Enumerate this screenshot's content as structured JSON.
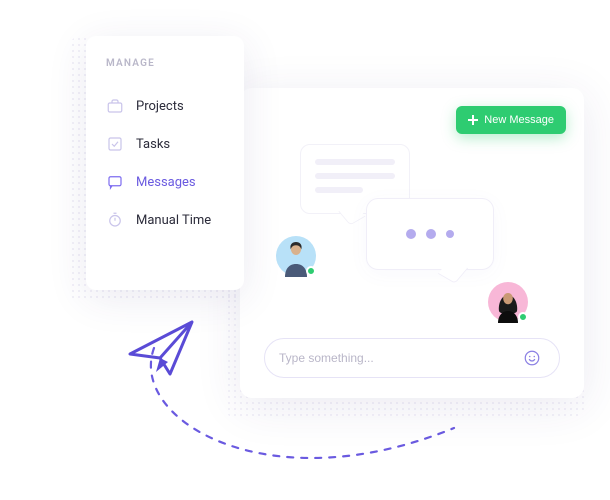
{
  "sidebar": {
    "title": "MANAGE",
    "items": [
      {
        "label": "Projects",
        "icon": "briefcase-icon",
        "active": false
      },
      {
        "label": "Tasks",
        "icon": "check-square-icon",
        "active": false
      },
      {
        "label": "Messages",
        "icon": "message-icon",
        "active": true
      },
      {
        "label": "Manual Time",
        "icon": "stopwatch-icon",
        "active": false
      }
    ]
  },
  "chat": {
    "new_message_label": "New Message",
    "input_placeholder": "Type something..."
  },
  "colors": {
    "accent": "#6a5ae0",
    "success": "#2ecc71"
  }
}
